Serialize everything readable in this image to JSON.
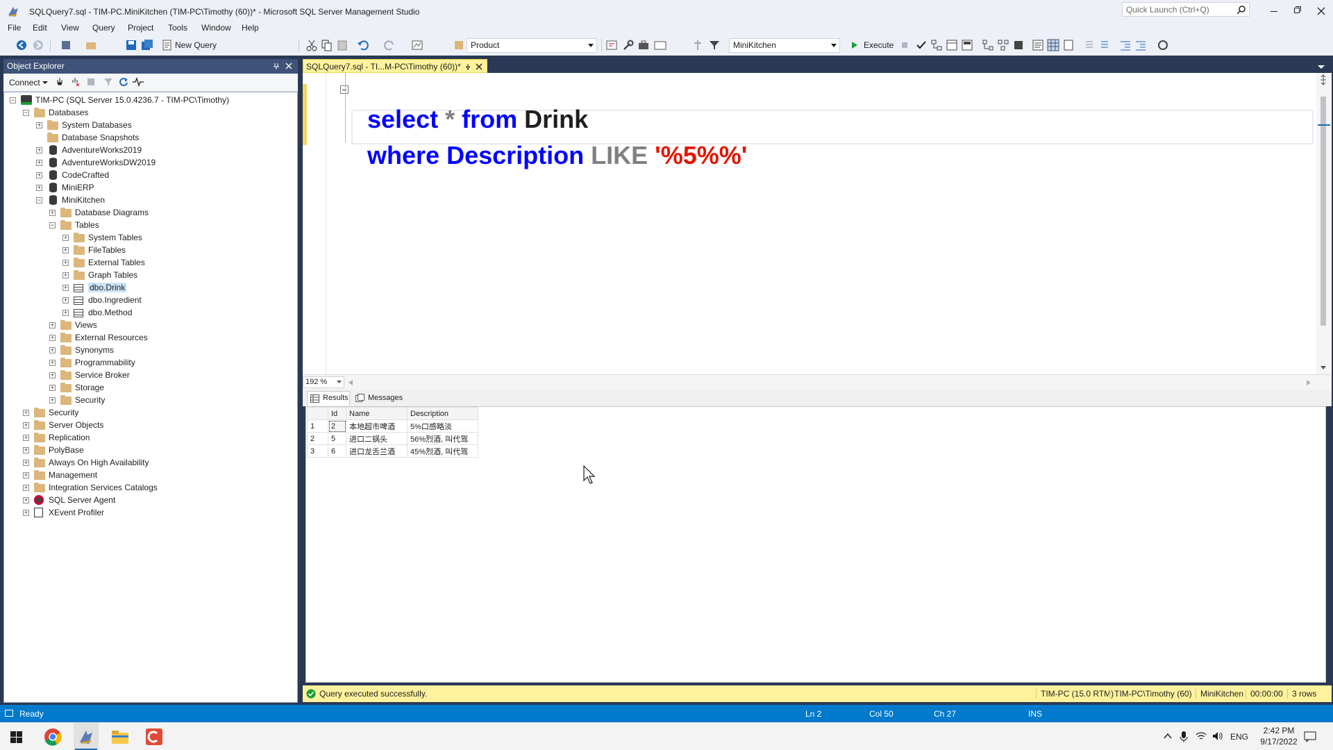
{
  "window": {
    "title": "SQLQuery7.sql - TIM-PC.MiniKitchen (TIM-PC\\Timothy (60))* - Microsoft SQL Server Management Studio",
    "quick_launch_placeholder": "Quick Launch (Ctrl+Q)"
  },
  "menu": [
    "File",
    "Edit",
    "View",
    "Query",
    "Project",
    "Tools",
    "Window",
    "Help"
  ],
  "toolbar": {
    "new_query": "New Query",
    "solution_combo": "Product",
    "database_combo": "MiniKitchen",
    "execute": "Execute"
  },
  "object_explorer": {
    "title": "Object Explorer",
    "connect": "Connect",
    "nodes": [
      {
        "label": "TIM-PC (SQL Server 15.0.4236.7 - TIM-PC\\Timothy)",
        "icon": "server-icon",
        "expanded": true
      },
      {
        "label": "Databases",
        "icon": "folder-icon",
        "expanded": true
      },
      {
        "label": "System Databases",
        "icon": "folder-icon",
        "expanded": false
      },
      {
        "label": "Database Snapshots",
        "icon": "folder-icon",
        "expanded": null
      },
      {
        "label": "AdventureWorks2019",
        "icon": "database-icon",
        "expanded": false
      },
      {
        "label": "AdventureWorksDW2019",
        "icon": "database-icon",
        "expanded": false
      },
      {
        "label": "CodeCrafted",
        "icon": "database-icon",
        "expanded": false
      },
      {
        "label": "MiniERP",
        "icon": "database-icon",
        "expanded": false
      },
      {
        "label": "MiniKitchen",
        "icon": "database-icon",
        "expanded": true
      },
      {
        "label": "Database Diagrams",
        "icon": "folder-icon",
        "expanded": false
      },
      {
        "label": "Tables",
        "icon": "folder-icon",
        "expanded": true
      },
      {
        "label": "System Tables",
        "icon": "folder-icon",
        "expanded": false
      },
      {
        "label": "FileTables",
        "icon": "folder-icon",
        "expanded": false
      },
      {
        "label": "External Tables",
        "icon": "folder-icon",
        "expanded": false
      },
      {
        "label": "Graph Tables",
        "icon": "folder-icon",
        "expanded": false
      },
      {
        "label": "dbo.Drink",
        "icon": "table-icon",
        "expanded": false
      },
      {
        "label": "dbo.Ingredient",
        "icon": "table-icon",
        "expanded": false
      },
      {
        "label": "dbo.Method",
        "icon": "table-icon",
        "expanded": false
      },
      {
        "label": "Views",
        "icon": "folder-icon",
        "expanded": false
      },
      {
        "label": "External Resources",
        "icon": "folder-icon",
        "expanded": false
      },
      {
        "label": "Synonyms",
        "icon": "folder-icon",
        "expanded": false
      },
      {
        "label": "Programmability",
        "icon": "folder-icon",
        "expanded": false
      },
      {
        "label": "Service Broker",
        "icon": "folder-icon",
        "expanded": false
      },
      {
        "label": "Storage",
        "icon": "folder-icon",
        "expanded": false
      },
      {
        "label": "Security",
        "icon": "folder-icon",
        "expanded": false
      },
      {
        "label": "Security",
        "icon": "folder-icon",
        "expanded": false
      },
      {
        "label": "Server Objects",
        "icon": "folder-icon",
        "expanded": false
      },
      {
        "label": "Replication",
        "icon": "folder-icon",
        "expanded": false
      },
      {
        "label": "PolyBase",
        "icon": "folder-icon",
        "expanded": false
      },
      {
        "label": "Always On High Availability",
        "icon": "folder-icon",
        "expanded": false
      },
      {
        "label": "Management",
        "icon": "folder-icon",
        "expanded": false
      },
      {
        "label": "Integration Services Catalogs",
        "icon": "folder-icon",
        "expanded": false
      },
      {
        "label": "SQL Server Agent",
        "icon": "agent-icon",
        "expanded": false
      },
      {
        "label": "XEvent Profiler",
        "icon": "profiler-icon",
        "expanded": false
      }
    ]
  },
  "editor": {
    "tab_title": "SQLQuery7.sql - TI...M-PC\\Timothy (60))*",
    "line1": {
      "kw1": "select",
      "star": "*",
      "kw2": "from",
      "table": "Drink"
    },
    "line2": {
      "kw": "where",
      "col": "Description",
      "op": "LIKE",
      "pattern_open": "'%",
      "pattern_mid": "5",
      "pattern_close": "%%'"
    },
    "zoom": "192 %"
  },
  "results": {
    "tab_results": "Results",
    "tab_messages": "Messages",
    "columns": [
      "",
      "Id",
      "Name",
      "Description"
    ],
    "rows": [
      [
        "1",
        "2",
        "本地超市啤酒",
        "5%口感略淡"
      ],
      [
        "2",
        "5",
        "进口二锅头",
        "56%烈酒, 叫代驾"
      ],
      [
        "3",
        "6",
        "进口龙舌兰酒",
        "45%烈酒, 叫代驾"
      ]
    ]
  },
  "query_status": {
    "message": "Query executed successfully.",
    "server": "TIM-PC (15.0 RTM)",
    "user": "TIM-PC\\Timothy (60)",
    "database": "MiniKitchen",
    "elapsed": "00:00:00",
    "rows": "3 rows"
  },
  "statusbar": {
    "state": "Ready",
    "ln": "Ln 2",
    "col": "Col 50",
    "ch": "Ch 27",
    "mode": "INS"
  },
  "taskbar": {
    "lang": "ENG",
    "time": "2:42 PM",
    "date": "9/17/2022"
  },
  "colors": {
    "accent": "#007acc",
    "tab_active": "#fff29d",
    "frame": "#293955",
    "keyword": "#0000ff",
    "string": "#e51400"
  }
}
